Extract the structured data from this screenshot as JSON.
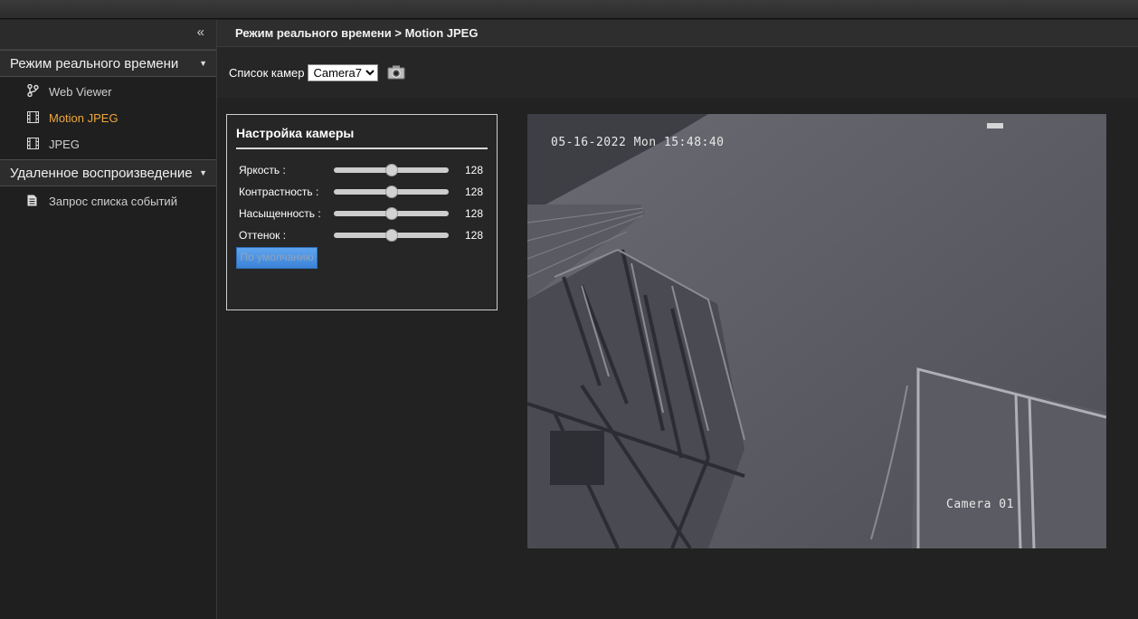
{
  "sidebar": {
    "sections": [
      {
        "label": "Режим реального времени",
        "items": [
          {
            "label": "Web Viewer",
            "icon": "branch-icon"
          },
          {
            "label": "Motion JPEG",
            "icon": "film-icon",
            "active": true
          },
          {
            "label": "JPEG",
            "icon": "film-icon"
          }
        ]
      },
      {
        "label": "Удаленное воспроизведение",
        "items": [
          {
            "label": "Запрос списка событий",
            "icon": "document-icon"
          }
        ]
      }
    ]
  },
  "breadcrumb": "Режим реального времени > Motion JPEG",
  "camera": {
    "label": "Список камер",
    "selected": "Camera7"
  },
  "settings": {
    "title": "Настройка камеры",
    "rows": [
      {
        "label": "Яркость :",
        "value": "128"
      },
      {
        "label": "Контрастность :",
        "value": "128"
      },
      {
        "label": "Насыщенность :",
        "value": "128"
      },
      {
        "label": "Оттенок :",
        "value": "128"
      }
    ],
    "slider_level_fraction": 0.5,
    "default_button": "По умолчанию"
  },
  "video": {
    "timestamp": "05-16-2022 Mon 15:48:40",
    "camera_name": "Camera 01"
  },
  "colors": {
    "active": "#f0a83a",
    "button": "#4a90e2"
  }
}
